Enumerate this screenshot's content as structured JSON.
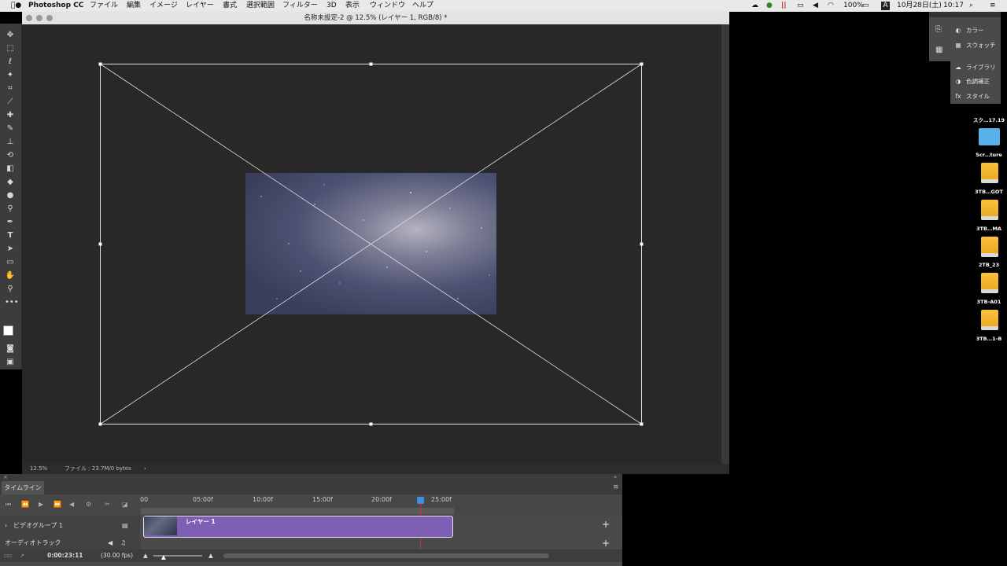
{
  "menubar": {
    "apple": "",
    "app_name": "Photoshop CC",
    "items": [
      "ファイル",
      "編集",
      "イメージ",
      "レイヤー",
      "書式",
      "選択範囲",
      "フィルター",
      "3D",
      "表示",
      "ウィンドウ",
      "ヘルプ"
    ],
    "battery": "100%",
    "input_mode": "A",
    "date": "10月28日(土)",
    "time": "10:17"
  },
  "document": {
    "title": "名称未設定-2 @ 12.5% (レイヤー 1, RGB/8) *",
    "zoom": "12.5%",
    "file_info": "ファイル : 23.7M/0 bytes",
    "chevron": "›"
  },
  "timeline": {
    "tab": "タイムライン",
    "ruler": [
      "00",
      "05:00f",
      "10:00f",
      "15:00f",
      "20:00f",
      "25:00f"
    ],
    "video_group": "ビデオグループ 1",
    "clip_label": "レイヤー 1",
    "audio_track": "オーディオトラック",
    "current_time": "0:00:23:11",
    "fps": "(30.00 fps)",
    "add": "+"
  },
  "panels": {
    "items": [
      "カラー",
      "スウォッチ",
      "ライブラリ",
      "色調補正",
      "スタイル"
    ]
  },
  "desktop": {
    "items": [
      "スク…17.19",
      "Scr…ture",
      "3TB…GOT",
      "3TB…MA",
      "2TB_23",
      "3TB-A01",
      "3TB…1-B"
    ]
  }
}
